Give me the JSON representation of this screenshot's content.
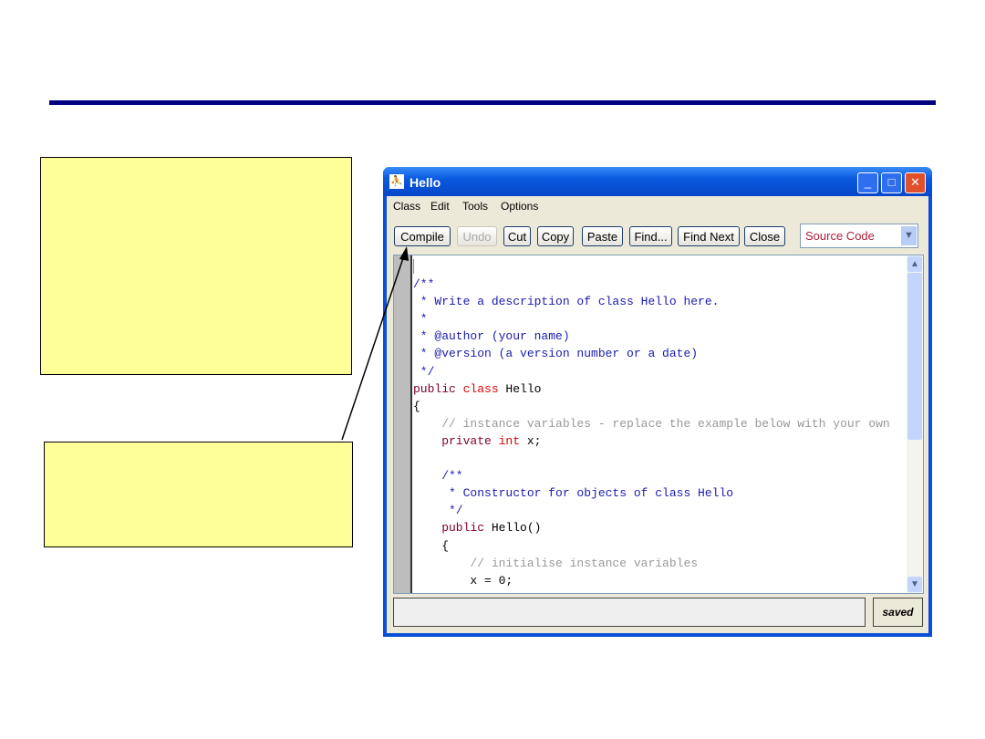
{
  "window": {
    "title": "Hello",
    "icon": "bluej-icon"
  },
  "menu": [
    "Class",
    "Edit",
    "Tools",
    "Options"
  ],
  "toolbar": {
    "buttons": [
      {
        "label": "Compile",
        "enabled": true
      },
      {
        "label": "Undo",
        "enabled": false
      },
      {
        "label": "Cut",
        "enabled": true
      },
      {
        "label": "Copy",
        "enabled": true
      },
      {
        "label": "Paste",
        "enabled": true
      },
      {
        "label": "Find...",
        "enabled": true
      },
      {
        "label": "Find Next",
        "enabled": true
      },
      {
        "label": "Close",
        "enabled": true
      }
    ],
    "view_select": "Source Code"
  },
  "code": [
    [],
    [
      [
        "/**",
        "doc"
      ]
    ],
    [
      [
        " * Write a description of class Hello here.",
        "doc"
      ]
    ],
    [
      [
        " *",
        "doc"
      ]
    ],
    [
      [
        " * @author (your name)",
        "doc"
      ]
    ],
    [
      [
        " * @version (a version number or a date)",
        "doc"
      ]
    ],
    [
      [
        " */",
        "doc"
      ]
    ],
    [
      [
        "public ",
        "kw"
      ],
      [
        "class ",
        "red"
      ],
      [
        "Hello",
        "n"
      ]
    ],
    [
      [
        "{",
        "n"
      ]
    ],
    [
      [
        "    // instance variables - replace the example below with your own",
        "cm"
      ]
    ],
    [
      [
        "    private ",
        "kw"
      ],
      [
        "int ",
        "red"
      ],
      [
        "x;",
        "n"
      ]
    ],
    [],
    [
      [
        "    /**",
        "doc"
      ]
    ],
    [
      [
        "     * Constructor for objects of class Hello",
        "doc"
      ]
    ],
    [
      [
        "     */",
        "doc"
      ]
    ],
    [
      [
        "    public ",
        "kw"
      ],
      [
        "Hello()",
        "n"
      ]
    ],
    [
      [
        "    {",
        "n"
      ]
    ],
    [
      [
        "        // initialise instance variables",
        "cm"
      ]
    ],
    [
      [
        "        x = 0;",
        "n"
      ]
    ]
  ],
  "status": {
    "message": "",
    "saved": "saved"
  },
  "colors": {
    "rule": "#000080",
    "note": "#ffff99",
    "doc": "#1a1ab0",
    "keyword": "#800030",
    "type": "#e00000",
    "comment": "#999999"
  }
}
